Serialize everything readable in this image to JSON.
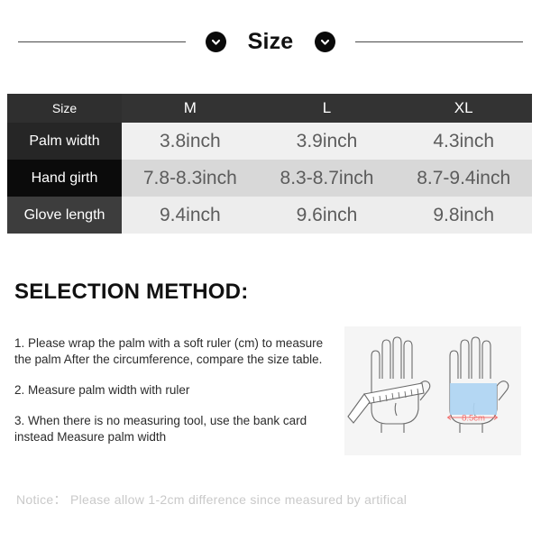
{
  "header": {
    "title": "Size",
    "left_badge_icon": "chevron-down-icon",
    "right_badge_icon": "chevron-down-icon"
  },
  "size_table": {
    "columns": [
      "Size",
      "M",
      "L",
      "XL"
    ],
    "rows": [
      {
        "label": "Palm width",
        "values": [
          "3.8inch",
          "3.9inch",
          "4.3inch"
        ]
      },
      {
        "label": "Hand girth",
        "values": [
          "7.8-8.3inch",
          "8.3-8.7inch",
          "8.7-9.4inch"
        ]
      },
      {
        "label": "Glove length",
        "values": [
          "9.4inch",
          "9.6inch",
          "9.8inch"
        ]
      }
    ]
  },
  "selection_method": {
    "title": "SELECTION METHOD:",
    "items": [
      "1. Please wrap the palm with a soft ruler (cm) to measure the palm After the circumference, compare the size table.",
      "2. Measure palm width with ruler",
      "3. When there is no measuring tool, use the bank card instead Measure palm width"
    ]
  },
  "illustration": {
    "left_hand_label": "hand-with-ruler",
    "right_hand_label": "hand-with-width-band",
    "measure_label": "8.5cm",
    "band_color": "#aed4f2",
    "measure_label_color": "#f2706e"
  },
  "notice": {
    "text": "Notice：  Please allow 1-2cm difference since measured by artifical"
  }
}
